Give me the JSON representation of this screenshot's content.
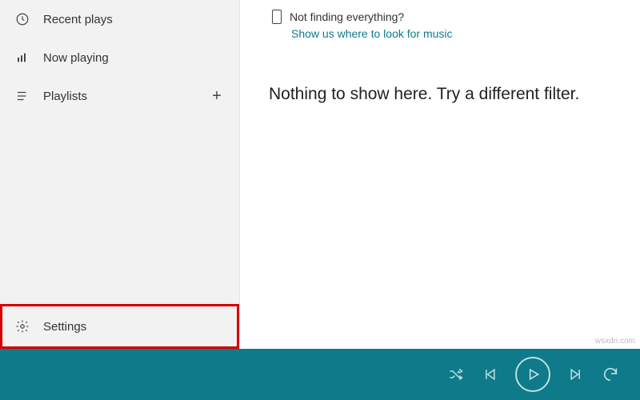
{
  "sidebar": {
    "recent_plays": "Recent plays",
    "now_playing": "Now playing",
    "playlists": "Playlists",
    "settings": "Settings"
  },
  "hint": {
    "line1": "Not finding everything?",
    "line2": "Show us where to look for music"
  },
  "main": {
    "empty_message": "Nothing to show here. Try a different filter."
  },
  "watermark": "wsxdn.com",
  "colors": {
    "accent": "#0e7a8a",
    "highlight_border": "#d60000"
  }
}
